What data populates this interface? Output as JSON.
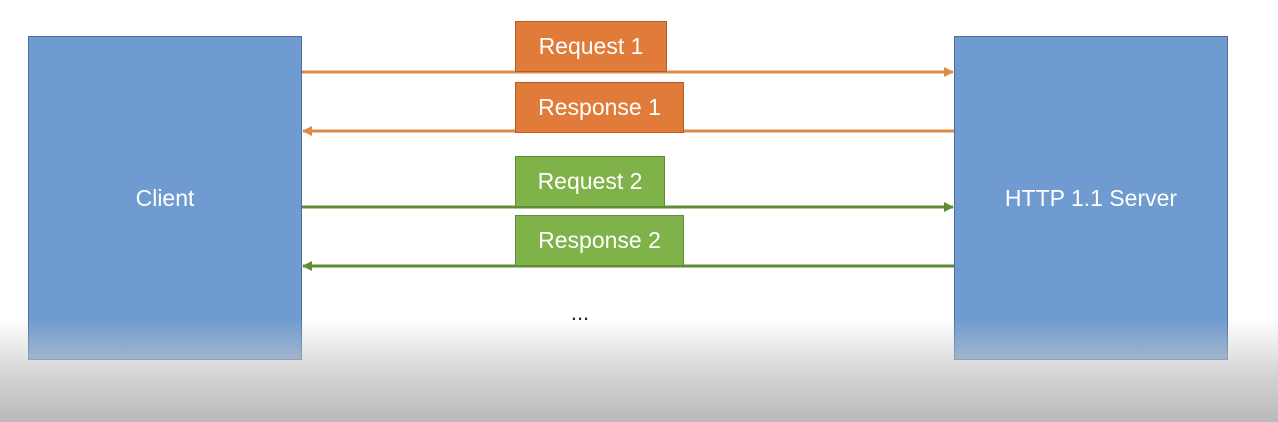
{
  "colors": {
    "node_fill": "#6f9bd1",
    "request1_fill": "#e07b39",
    "response1_fill": "#e07b39",
    "request2_fill": "#7fb34a",
    "response2_fill": "#7fb34a",
    "arrow1": "#e08a4a",
    "arrow2": "#5f8d35"
  },
  "nodes": {
    "client": {
      "label": "Client"
    },
    "server": {
      "label": "HTTP 1.1 Server"
    }
  },
  "messages": [
    {
      "label": "Request 1",
      "direction": "client-to-server"
    },
    {
      "label": "Response 1",
      "direction": "server-to-client"
    },
    {
      "label": "Request 2",
      "direction": "client-to-server"
    },
    {
      "label": "Response 2",
      "direction": "server-to-client"
    }
  ],
  "continuation": "..."
}
